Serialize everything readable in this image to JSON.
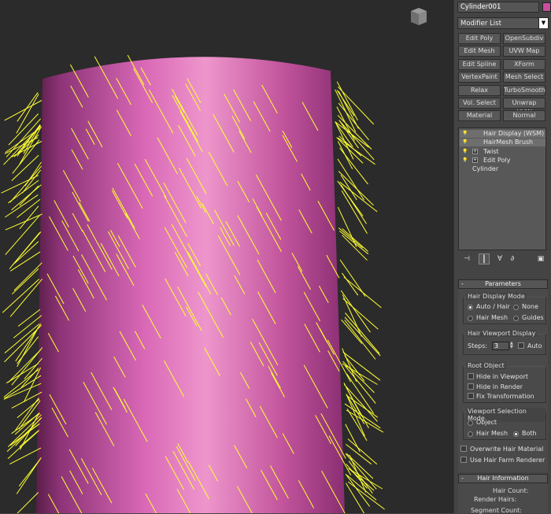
{
  "object_name": "Cylinder001",
  "object_color": "#c94f9b",
  "modifier_list_label": "Modifier List",
  "modifier_list_arrow": "▼",
  "modifier_buttons": [
    "Edit Poly",
    "OpenSubdiv",
    "Edit Mesh",
    "UVW Map",
    "Edit Spline",
    "XForm",
    "VertexPaint",
    "Mesh Select",
    "Relax",
    "TurboSmooth",
    "Vol. Select",
    "Unwrap UVW",
    "Material",
    "Normal"
  ],
  "stack": [
    {
      "label": "Hair Display (WSM)",
      "bulb": true,
      "plus": false,
      "selected": true
    },
    {
      "label": "HairMesh Brush",
      "bulb": true,
      "plus": false,
      "selected": true
    },
    {
      "label": "Twist",
      "bulb": true,
      "plus": true,
      "selected": false
    },
    {
      "label": "Edit Poly",
      "bulb": true,
      "plus": true,
      "selected": false
    },
    {
      "label": "Cylinder",
      "bulb": false,
      "plus": false,
      "selected": false
    }
  ],
  "toolstrip_icons": [
    "pin-stack-icon",
    "show-end-result-icon",
    "make-unique-icon",
    "remove-modifier-icon",
    "configure-modifier-sets-icon"
  ],
  "params": {
    "title": "Parameters",
    "collapse": "-",
    "hair_display_mode": {
      "title": "Hair Display Mode",
      "options": [
        {
          "label": "Auto / Hair",
          "on": true
        },
        {
          "label": "None",
          "on": false
        },
        {
          "label": "Hair Mesh",
          "on": false
        },
        {
          "label": "Guides",
          "on": false
        }
      ]
    },
    "viewport_display": {
      "title": "Hair Viewport Display",
      "steps_label": "Steps:",
      "steps_value": "3",
      "auto_label": "Auto"
    },
    "root_object": {
      "title": "Root Object",
      "options": [
        "Hide in Viewport",
        "Hide in Render",
        "Fix Transformation"
      ]
    },
    "viewport_selection": {
      "title": "Viewport Selection Mode",
      "options": [
        {
          "label": "Object",
          "on": false
        },
        {
          "label": "Hair Mesh",
          "on": false
        },
        {
          "label": "Both",
          "on": true
        }
      ]
    },
    "overwrite_hair_material": "Overwrite Hair Material",
    "use_hair_farm_renderer": "Use Hair Farm Renderer"
  },
  "hair_info": {
    "title": "Hair Information",
    "collapse": "-",
    "rows": [
      "Hair Count:",
      "Render Hairs:",
      "Segment Count:"
    ]
  },
  "colors": {
    "cylinder": "#d05aa8",
    "cylinder_highlight": "#ec90c8",
    "hair": "#ffff33",
    "viewport_bg": "#2b2b2b"
  }
}
